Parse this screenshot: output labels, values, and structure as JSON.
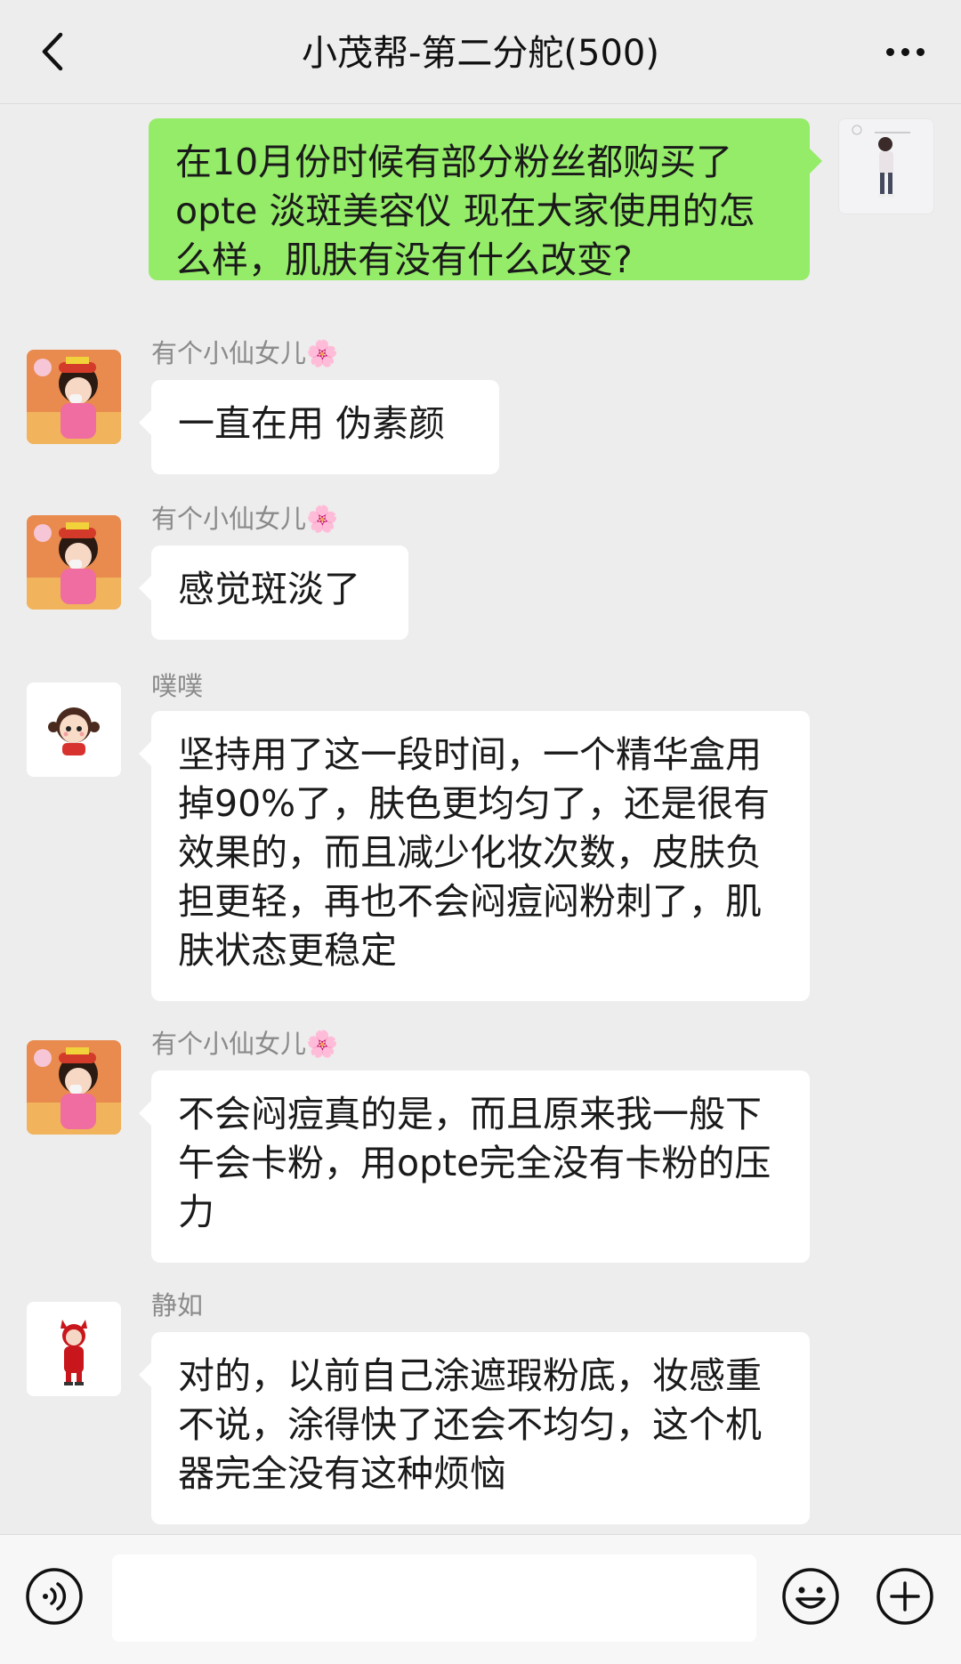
{
  "header": {
    "title": "小茂帮-第二分舵(500)"
  },
  "messages": [
    {
      "side": "right",
      "text": "在10月份时候有部分粉丝都购买了opte 淡斑美容仪 现在大家使用的怎么样，肌肤有没有什么改变?"
    },
    {
      "side": "left",
      "sender": "有个小仙女儿🌸",
      "text": "一直在用 伪素颜"
    },
    {
      "side": "left",
      "sender": "有个小仙女儿🌸",
      "text": "感觉斑淡了"
    },
    {
      "side": "left",
      "sender": "噗噗",
      "text": "坚持用了这一段时间，一个精华盒用掉90%了，肤色更均匀了，还是很有效果的，而且减少化妆次数，皮肤负担更轻，再也不会闷痘闷粉刺了，肌肤状态更稳定"
    },
    {
      "side": "left",
      "sender": "有个小仙女儿🌸",
      "text": "不会闷痘真的是，而且原来我一般下午会卡粉，用opte完全没有卡粉的压力"
    },
    {
      "side": "left",
      "sender": "静如",
      "text": "对的，以前自己涂遮瑕粉底，妆感重不说，涂得快了还会不均匀，这个机器完全没有这种烦恼"
    }
  ],
  "colors": {
    "background": "#ededed",
    "bubble_self": "#95ec69",
    "bubble_other": "#ffffff",
    "name_text": "#8a8a8a"
  },
  "input_bar": {
    "placeholder": "",
    "voice_icon": "voice-icon",
    "emoji_icon": "emoji-icon",
    "plus_icon": "plus-icon"
  }
}
